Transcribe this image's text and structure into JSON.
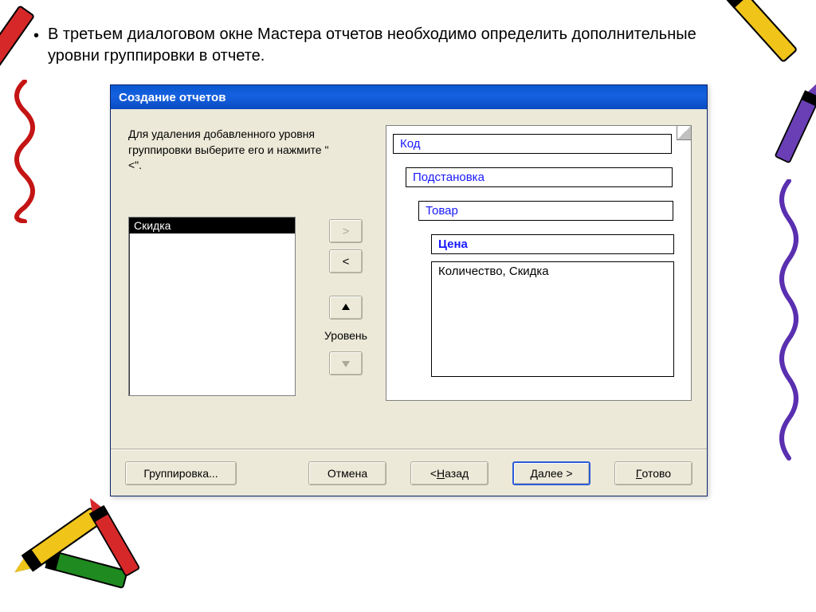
{
  "bullet": "В третьем диалоговом окне Мастера отчетов необходимо определить дополнительные уровни группировки в отчете.",
  "dialog": {
    "title": "Создание отчетов",
    "description": "Для удаления добавленного уровня группировки выберите его и нажмите \"<\".",
    "listbox": {
      "selected": "Скидка"
    },
    "arrows": {
      "add": ">",
      "remove": "<",
      "level_label": "Уровень",
      "up": "⬆",
      "down": "⬇"
    },
    "preview": {
      "groups": [
        "Код",
        "Подстановка",
        "Товар",
        "Цена"
      ],
      "detail": "Количество, Скидка"
    },
    "buttons": {
      "grouping": "Группировка...",
      "cancel": "Отмена",
      "back_prefix": "< ",
      "back_u": "Н",
      "back_rest": "азад",
      "next_u": "Д",
      "next_rest": "алее >",
      "finish_u": "Г",
      "finish_rest": "отово"
    }
  }
}
